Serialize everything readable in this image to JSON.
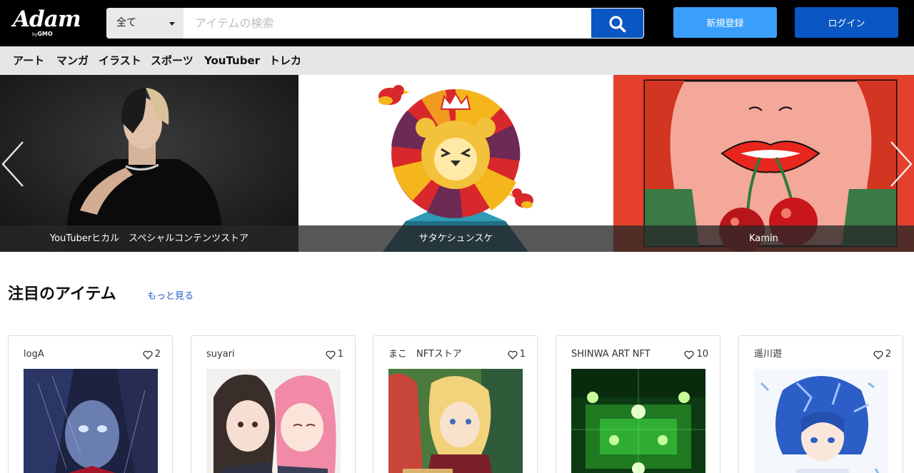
{
  "header": {
    "logo_text": "Adam",
    "logo_sub_by": "by",
    "logo_sub_brand": "GMO",
    "search": {
      "category": "全て",
      "placeholder": "アイテムの検索",
      "value": ""
    },
    "register_label": "新規登録",
    "login_label": "ログイン"
  },
  "categories": [
    "アート",
    "マンガ",
    "イラスト",
    "スポーツ",
    "YouTuber",
    "トレカ"
  ],
  "banner": {
    "slides": [
      {
        "caption": "YouTuberヒカル　スペシャルコンテンツストア"
      },
      {
        "caption": "サタケシュンスケ"
      },
      {
        "caption": "Kamin"
      }
    ]
  },
  "featured": {
    "title": "注目のアイテム",
    "more_label": "もっと見る",
    "items": [
      {
        "creator": "logA",
        "likes": "2"
      },
      {
        "creator": "suyari",
        "likes": "1"
      },
      {
        "creator": "まこ　NFTストア",
        "likes": "1"
      },
      {
        "creator": "SHINWA ART NFT",
        "likes": "10"
      },
      {
        "creator": "遥川遊",
        "likes": "2"
      }
    ]
  },
  "colors": {
    "header_bg": "#000000",
    "accent_blue": "#0a56c2",
    "register_blue": "#3a9ffb",
    "nav_bg": "#e6e6e6",
    "link_blue": "#1f5fc4"
  }
}
